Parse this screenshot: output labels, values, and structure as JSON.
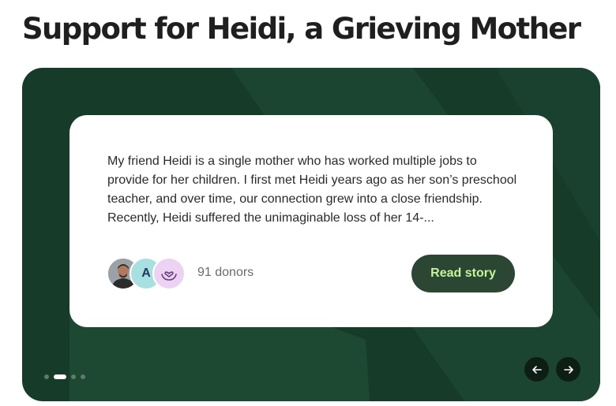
{
  "page": {
    "title": "Support for Heidi, a Grieving Mother"
  },
  "carousel": {
    "active_slide": 2,
    "slide_count": 4,
    "card": {
      "story_excerpt": "My friend Heidi is a single mother who has worked multiple jobs to provide for her children. I first met Heidi years ago as her son’s preschool teacher, and over time, our connection grew into a close friendship. Recently, Heidi suffered the unimaginable loss of her 14-...",
      "avatars": [
        {
          "type": "photo",
          "icon": "person-photo-icon"
        },
        {
          "type": "letter",
          "letter": "A",
          "color": "#a8e0e0"
        },
        {
          "type": "icon",
          "icon": "heart-hands-icon",
          "color": "#ecd3f3"
        }
      ],
      "donors_text": "91 donors",
      "read_button_label": "Read story"
    },
    "colors": {
      "background": "#163b28",
      "button_bg": "#2b4734",
      "button_text": "#c4f59a"
    },
    "nav": {
      "prev_icon": "arrow-left-icon",
      "next_icon": "arrow-right-icon"
    }
  }
}
